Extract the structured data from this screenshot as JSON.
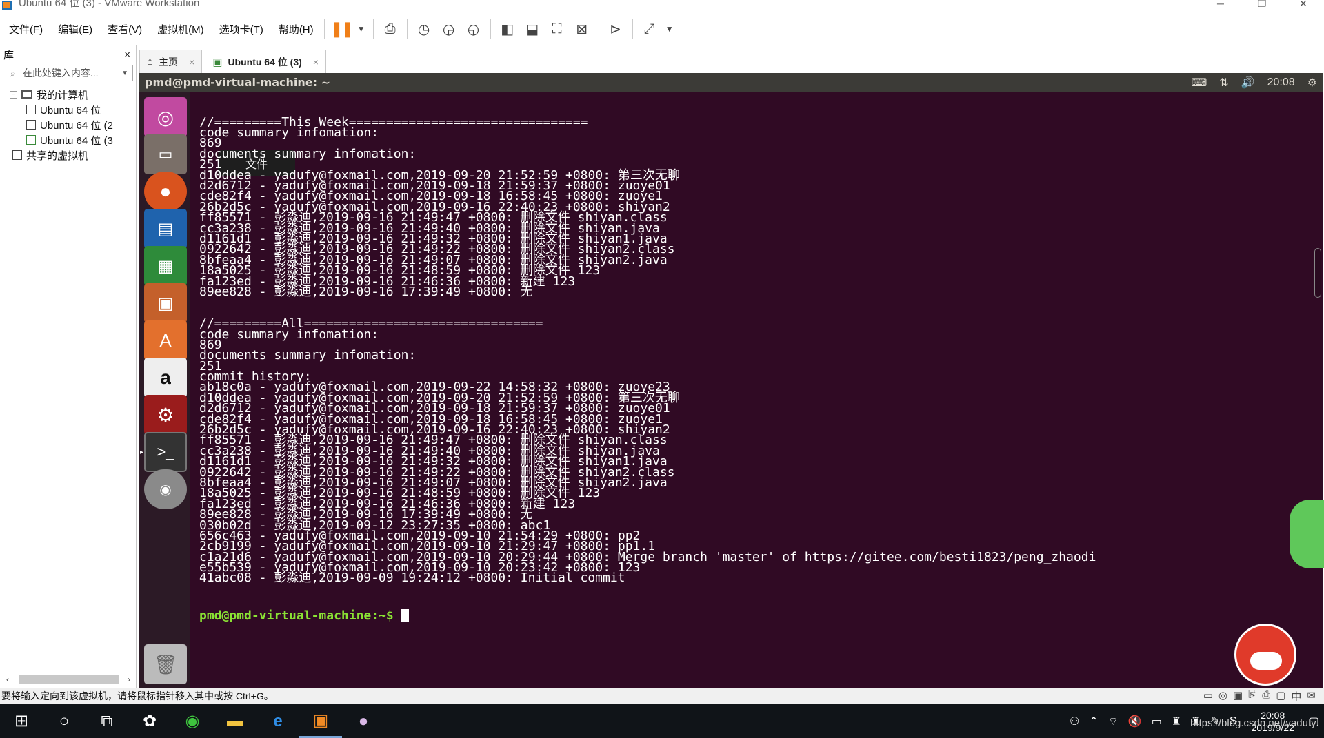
{
  "window": {
    "title": "Ubuntu 64 位 (3) - VMware Workstation"
  },
  "menubar": {
    "items": [
      "文件(F)",
      "编辑(E)",
      "查看(V)",
      "虚拟机(M)",
      "选项卡(T)",
      "帮助(H)"
    ]
  },
  "library": {
    "title": "库",
    "close": "×",
    "search_placeholder": "在此处键入内容...",
    "tree": {
      "root": "我的计算机",
      "vms": [
        "Ubuntu 64 位",
        "Ubuntu 64 位 (2",
        "Ubuntu 64 位 (3"
      ],
      "shared": "共享的虚拟机"
    }
  },
  "tabs": [
    {
      "label": "主页",
      "close": "×"
    },
    {
      "label": "Ubuntu 64 位 (3)",
      "close": "×"
    }
  ],
  "ubuntu_panel": {
    "hostname": "pmd@pmd-virtual-machine: ~",
    "time": "20:08"
  },
  "launcher": {
    "tooltip": "文件",
    "apps": [
      "ubuntu-dash",
      "files",
      "firefox",
      "libreoffice-writer",
      "libreoffice-calc",
      "libreoffice-impress",
      "software-center",
      "amazon",
      "system-settings",
      "terminal",
      "dvd",
      "trash"
    ]
  },
  "terminal": {
    "lines": [
      "//=========This Week================================",
      "code summary infomation:",
      "869",
      "documents summary infomation:",
      "251",
      "d10ddea - yadufy@foxmail.com,2019-09-20 21:52:59 +0800: 第三次无聊",
      "d2d6712 - yadufy@foxmail.com,2019-09-18 21:59:37 +0800: zuoye01",
      "cde82f4 - yadufy@foxmail.com,2019-09-18 16:58:45 +0800: zuoye1",
      "26b2d5c - yadufy@foxmail.com,2019-09-16 22:40:23 +0800: shiyan2",
      "ff85571 - 彭淼迪,2019-09-16 21:49:47 +0800: 删除文件 shiyan.class",
      "cc3a238 - 彭淼迪,2019-09-16 21:49:40 +0800: 删除文件 shiyan.java",
      "d1161d1 - 彭淼迪,2019-09-16 21:49:32 +0800: 删除文件 shiyan1.java",
      "0922642 - 彭淼迪,2019-09-16 21:49:22 +0800: 删除文件 shiyan2.class",
      "8bfeaa4 - 彭淼迪,2019-09-16 21:49:07 +0800: 删除文件 shiyan2.java",
      "18a5025 - 彭淼迪,2019-09-16 21:48:59 +0800: 删除文件 123",
      "fa123ed - 彭淼迪,2019-09-16 21:46:36 +0800: 新建 123",
      "89ee828 - 彭淼迪,2019-09-16 17:39:49 +0800: 无",
      "",
      "",
      "//=========All================================",
      "code summary infomation:",
      "869",
      "documents summary infomation:",
      "251",
      "commit history:",
      "ab18c0a - yadufy@foxmail.com,2019-09-22 14:58:32 +0800: zuoye23",
      "d10ddea - yadufy@foxmail.com,2019-09-20 21:52:59 +0800: 第三次无聊",
      "d2d6712 - yadufy@foxmail.com,2019-09-18 21:59:37 +0800: zuoye01",
      "cde82f4 - yadufy@foxmail.com,2019-09-18 16:58:45 +0800: zuoye1",
      "26b2d5c - yadufy@foxmail.com,2019-09-16 22:40:23 +0800: shiyan2",
      "ff85571 - 彭淼迪,2019-09-16 21:49:47 +0800: 删除文件 shiyan.class",
      "cc3a238 - 彭淼迪,2019-09-16 21:49:40 +0800: 删除文件 shiyan.java",
      "d1161d1 - 彭淼迪,2019-09-16 21:49:32 +0800: 删除文件 shiyan1.java",
      "0922642 - 彭淼迪,2019-09-16 21:49:22 +0800: 删除文件 shiyan2.class",
      "8bfeaa4 - 彭淼迪,2019-09-16 21:49:07 +0800: 删除文件 shiyan2.java",
      "18a5025 - 彭淼迪,2019-09-16 21:48:59 +0800: 删除文件 123",
      "fa123ed - 彭淼迪,2019-09-16 21:46:36 +0800: 新建 123",
      "89ee828 - 彭淼迪,2019-09-16 17:39:49 +0800: 无",
      "030b02d - 彭淼迪,2019-09-12 23:27:35 +0800: abc1",
      "656c463 - yadufy@foxmail.com,2019-09-10 21:54:29 +0800: pp2",
      "2cb9199 - yadufy@foxmail.com,2019-09-10 21:29:47 +0800: pp1.1",
      "c1a21d6 - yadufy@foxmail.com,2019-09-10 20:29:44 +0800: Merge branch 'master' of https://gitee.com/besti1823/peng_zhaodi",
      "e55b539 - yadufy@foxmail.com,2019-09-10 20:23:42 +0800: 123",
      "41abc08 - 彭淼迪,2019-09-09 19:24:12 +0800: Initial commit"
    ],
    "prompt": "pmd@pmd-virtual-machine:~$"
  },
  "statusbar": {
    "message": "要将输入定向到该虚拟机，请将鼠标指针移入其中或按 Ctrl+G。"
  },
  "taskbar": {
    "time": "20:08",
    "date": "2019/9/22",
    "watermark": "https://blog.csdn.net/yadufy_"
  }
}
